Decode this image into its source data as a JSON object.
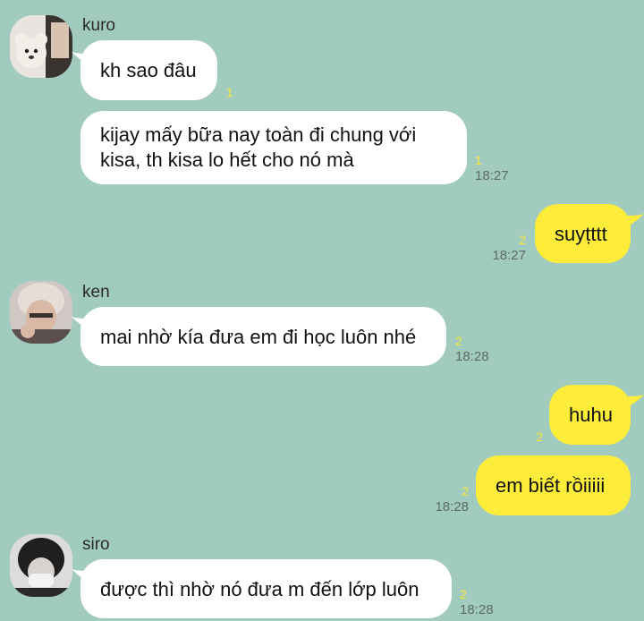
{
  "colors": {
    "background": "#a2cbbf",
    "incoming_bubble": "#ffffff",
    "outgoing_bubble": "#fdec3a",
    "unread_count": "#f6e63a",
    "timestamp": "#5c6b67"
  },
  "messages": [
    {
      "sender": "kuro",
      "avatar": "kuro-avatar",
      "text": "kh sao đâu",
      "unread": "1",
      "time": ""
    },
    {
      "sender": "",
      "text_line1": "kijay mấy bữa nay toàn đi chung với",
      "text_line2": "kisa, th kisa lo hết cho nó mà",
      "unread": "1",
      "time": "18:27"
    },
    {
      "sender": "me",
      "text": "suyṭttt",
      "unread": "2",
      "time": "18:27"
    },
    {
      "sender": "ken",
      "avatar": "ken-avatar",
      "text": "mai nhờ kía đưa em đi học luôn nhé",
      "unread": "2",
      "time": "18:28"
    },
    {
      "sender": "me",
      "text": "huhu",
      "unread": "2",
      "time": ""
    },
    {
      "sender": "me",
      "text": "em biết rồiiiii",
      "unread": "2",
      "time": "18:28"
    },
    {
      "sender": "siro",
      "avatar": "siro-avatar",
      "text": "được thì nhờ nó đưa m đến lớp luôn",
      "unread": "2",
      "time": "18:28"
    }
  ]
}
